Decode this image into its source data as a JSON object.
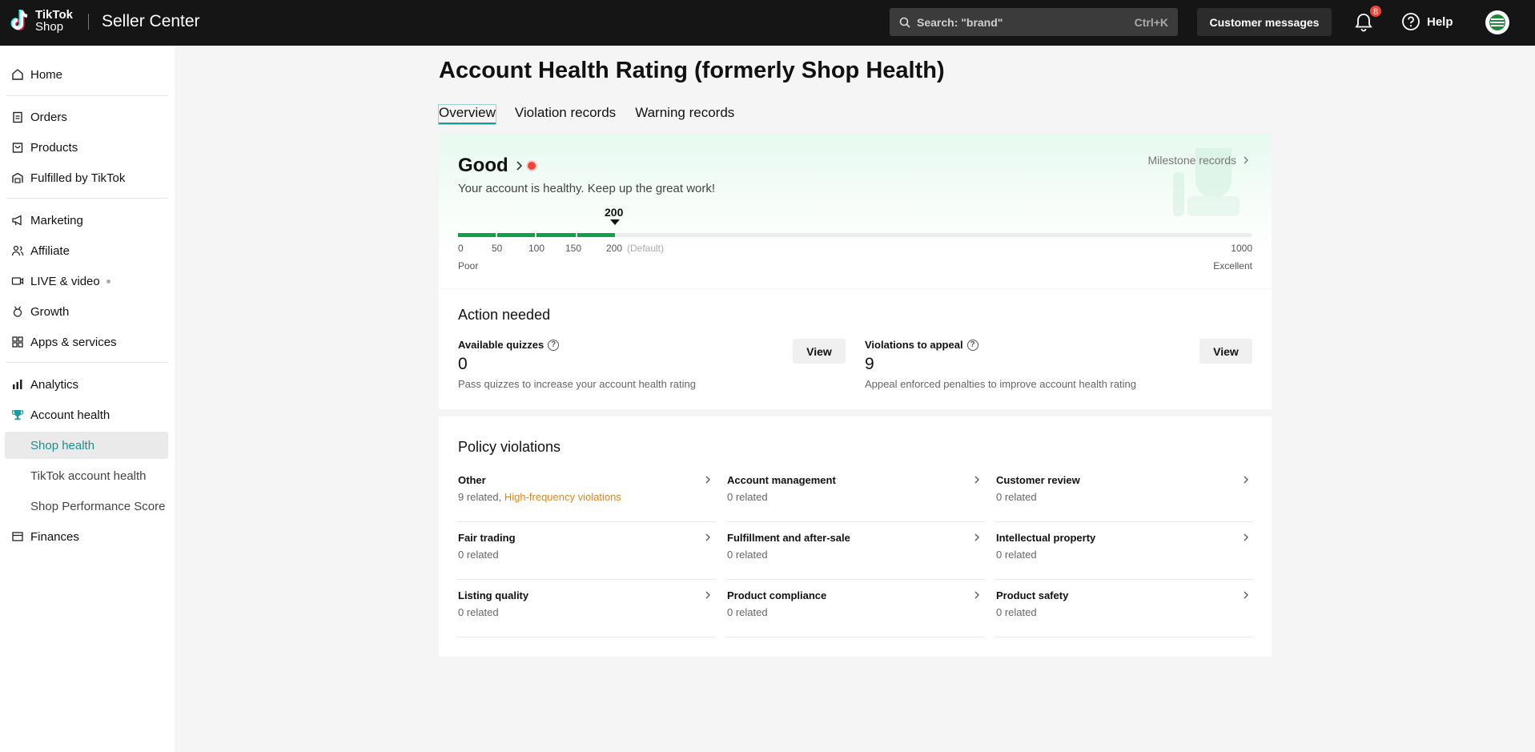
{
  "header": {
    "logo_line1": "TikTok",
    "logo_line2": "Shop",
    "app_title": "Seller Center",
    "search_placeholder": "Search: \"brand\"",
    "search_shortcut": "Ctrl+K",
    "customer_messages": "Customer messages",
    "notification_count": "8",
    "help_label": "Help"
  },
  "sidebar": {
    "home": "Home",
    "orders": "Orders",
    "products": "Products",
    "fulfilled": "Fulfilled by TikTok",
    "marketing": "Marketing",
    "affiliate": "Affiliate",
    "live_video": "LIVE & video",
    "growth": "Growth",
    "apps": "Apps & services",
    "analytics": "Analytics",
    "account_health": "Account health",
    "shop_health": "Shop health",
    "tiktok_account_health": "TikTok account health",
    "shop_performance": "Shop Performance Score",
    "finances": "Finances"
  },
  "page": {
    "title": "Account Health Rating (formerly Shop Health)",
    "tabs": [
      "Overview",
      "Violation records",
      "Warning records"
    ]
  },
  "health": {
    "status": "Good",
    "message": "Your account is healthy. Keep up the great work!",
    "milestone_label": "Milestone records",
    "score": "200",
    "score_value": 200,
    "max_value": 1000,
    "ticks": [
      "0",
      "50",
      "100",
      "150",
      "200"
    ],
    "default_label": "(Default)",
    "max_label": "1000",
    "low_label": "Poor",
    "high_label": "Excellent"
  },
  "action": {
    "title": "Action needed",
    "quizzes_label": "Available quizzes",
    "quizzes_value": "0",
    "quizzes_desc": "Pass quizzes to increase your account health rating",
    "appeal_label": "Violations to appeal",
    "appeal_value": "9",
    "appeal_desc": "Appeal enforced penalties to improve account health rating",
    "view_label": "View"
  },
  "policy": {
    "title": "Policy violations",
    "items": [
      {
        "name": "Other",
        "count": "9 related,",
        "extra": "High-frequency violations"
      },
      {
        "name": "Account management",
        "count": "0 related",
        "extra": ""
      },
      {
        "name": "Customer review",
        "count": "0 related",
        "extra": ""
      },
      {
        "name": "Fair trading",
        "count": "0 related",
        "extra": ""
      },
      {
        "name": "Fulfillment and after-sale",
        "count": "0 related",
        "extra": ""
      },
      {
        "name": "Intellectual property",
        "count": "0 related",
        "extra": ""
      },
      {
        "name": "Listing quality",
        "count": "0 related",
        "extra": ""
      },
      {
        "name": "Product compliance",
        "count": "0 related",
        "extra": ""
      },
      {
        "name": "Product safety",
        "count": "0 related",
        "extra": ""
      }
    ]
  }
}
